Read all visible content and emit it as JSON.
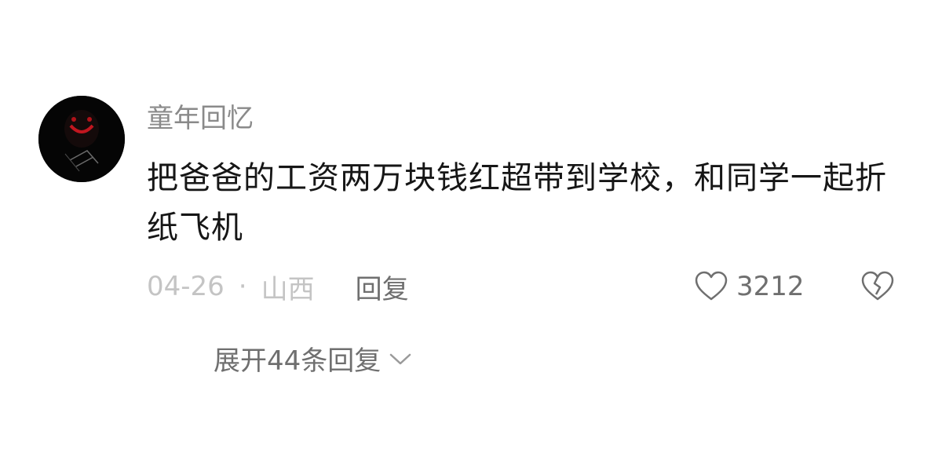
{
  "comment": {
    "username": "童年回忆",
    "text": "把爸爸的工资两万块钱红超带到学校，和同学一起折纸飞机",
    "date": "04-26",
    "separator": "·",
    "location": "山西",
    "reply_label": "回复",
    "like_count": "3212",
    "expand_replies_label": "展开44条回复"
  },
  "icons": {
    "avatar": "dark-avatar-with-red-smile",
    "like": "heart-outline-icon",
    "dislike": "broken-heart-icon",
    "expand": "chevron-down-icon"
  },
  "colors": {
    "username": "#8a8a8a",
    "text": "#161616",
    "meta": "#c4c4c4",
    "action": "#6f6f6f"
  }
}
